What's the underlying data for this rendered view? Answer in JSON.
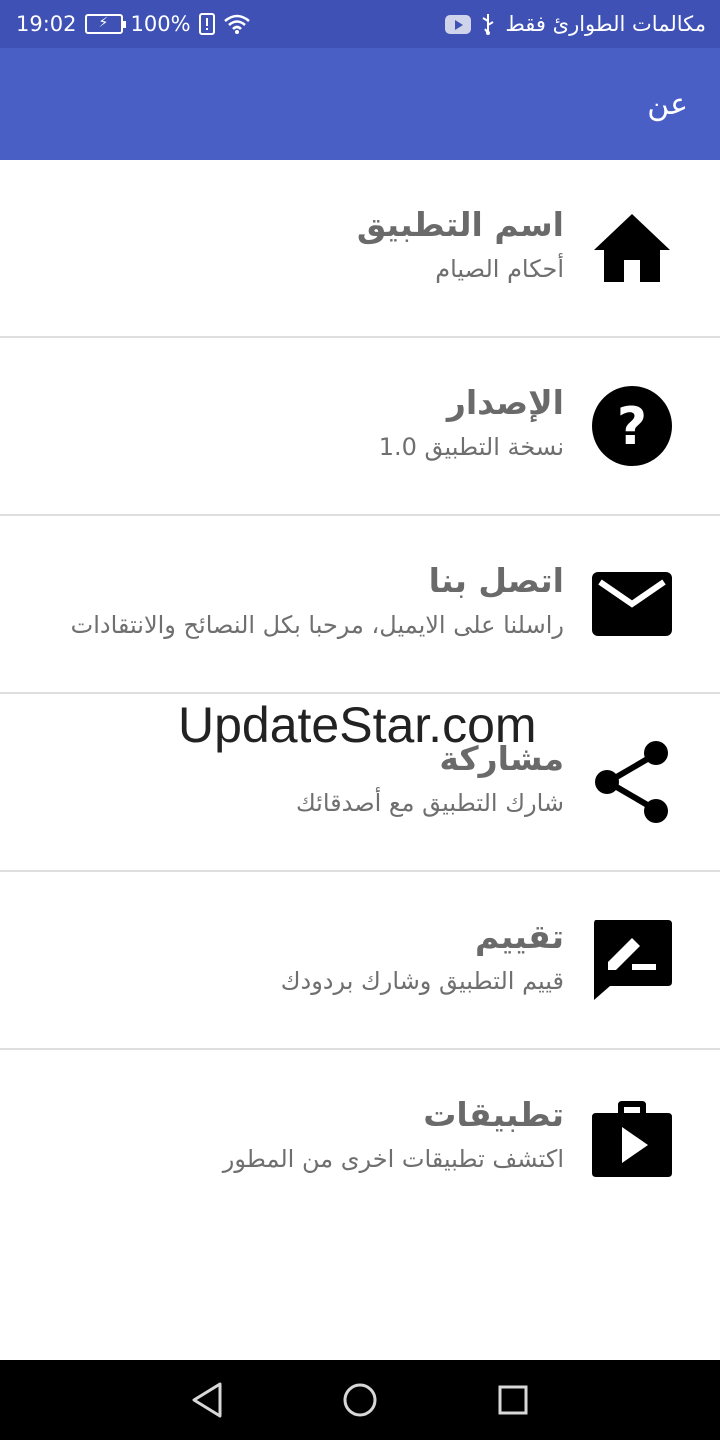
{
  "status_bar": {
    "time": "19:02",
    "battery": "100%",
    "carrier": "مكالمات الطوارئ فقط",
    "icons": [
      "battery-icon",
      "alert-icon",
      "wifi-icon",
      "youtube-icon",
      "usb-icon"
    ]
  },
  "app_bar": {
    "title": "عن"
  },
  "items": [
    {
      "title": "اسم التطبيق",
      "subtitle": "أحكام الصيام",
      "icon": "home-icon"
    },
    {
      "title": "الإصدار",
      "subtitle": "نسخة التطبيق 1.0",
      "icon": "help-icon"
    },
    {
      "title": "اتصل بنا",
      "subtitle": "راسلنا على الايميل، مرحبا بكل النصائح والانتقادات",
      "icon": "mail-icon"
    },
    {
      "title": "مشاركة",
      "subtitle": "شارك التطبيق مع أصدقائك",
      "icon": "share-icon"
    },
    {
      "title": "تقييم",
      "subtitle": "قييم التطبيق وشارك بردودك",
      "icon": "rate-review-icon"
    },
    {
      "title": "تطبيقات",
      "subtitle": "اكتشف تطبيقات اخرى من المطور",
      "icon": "play-store-icon"
    }
  ],
  "watermark": "UpdateStar.com",
  "nav_bar": {
    "buttons": [
      "back-icon",
      "home-circle-icon",
      "recents-icon"
    ]
  },
  "colors": {
    "status_bar": "#3f51b5",
    "app_bar": "#4a5fc6",
    "icon": "#000000",
    "title": "#6a6a6a"
  }
}
